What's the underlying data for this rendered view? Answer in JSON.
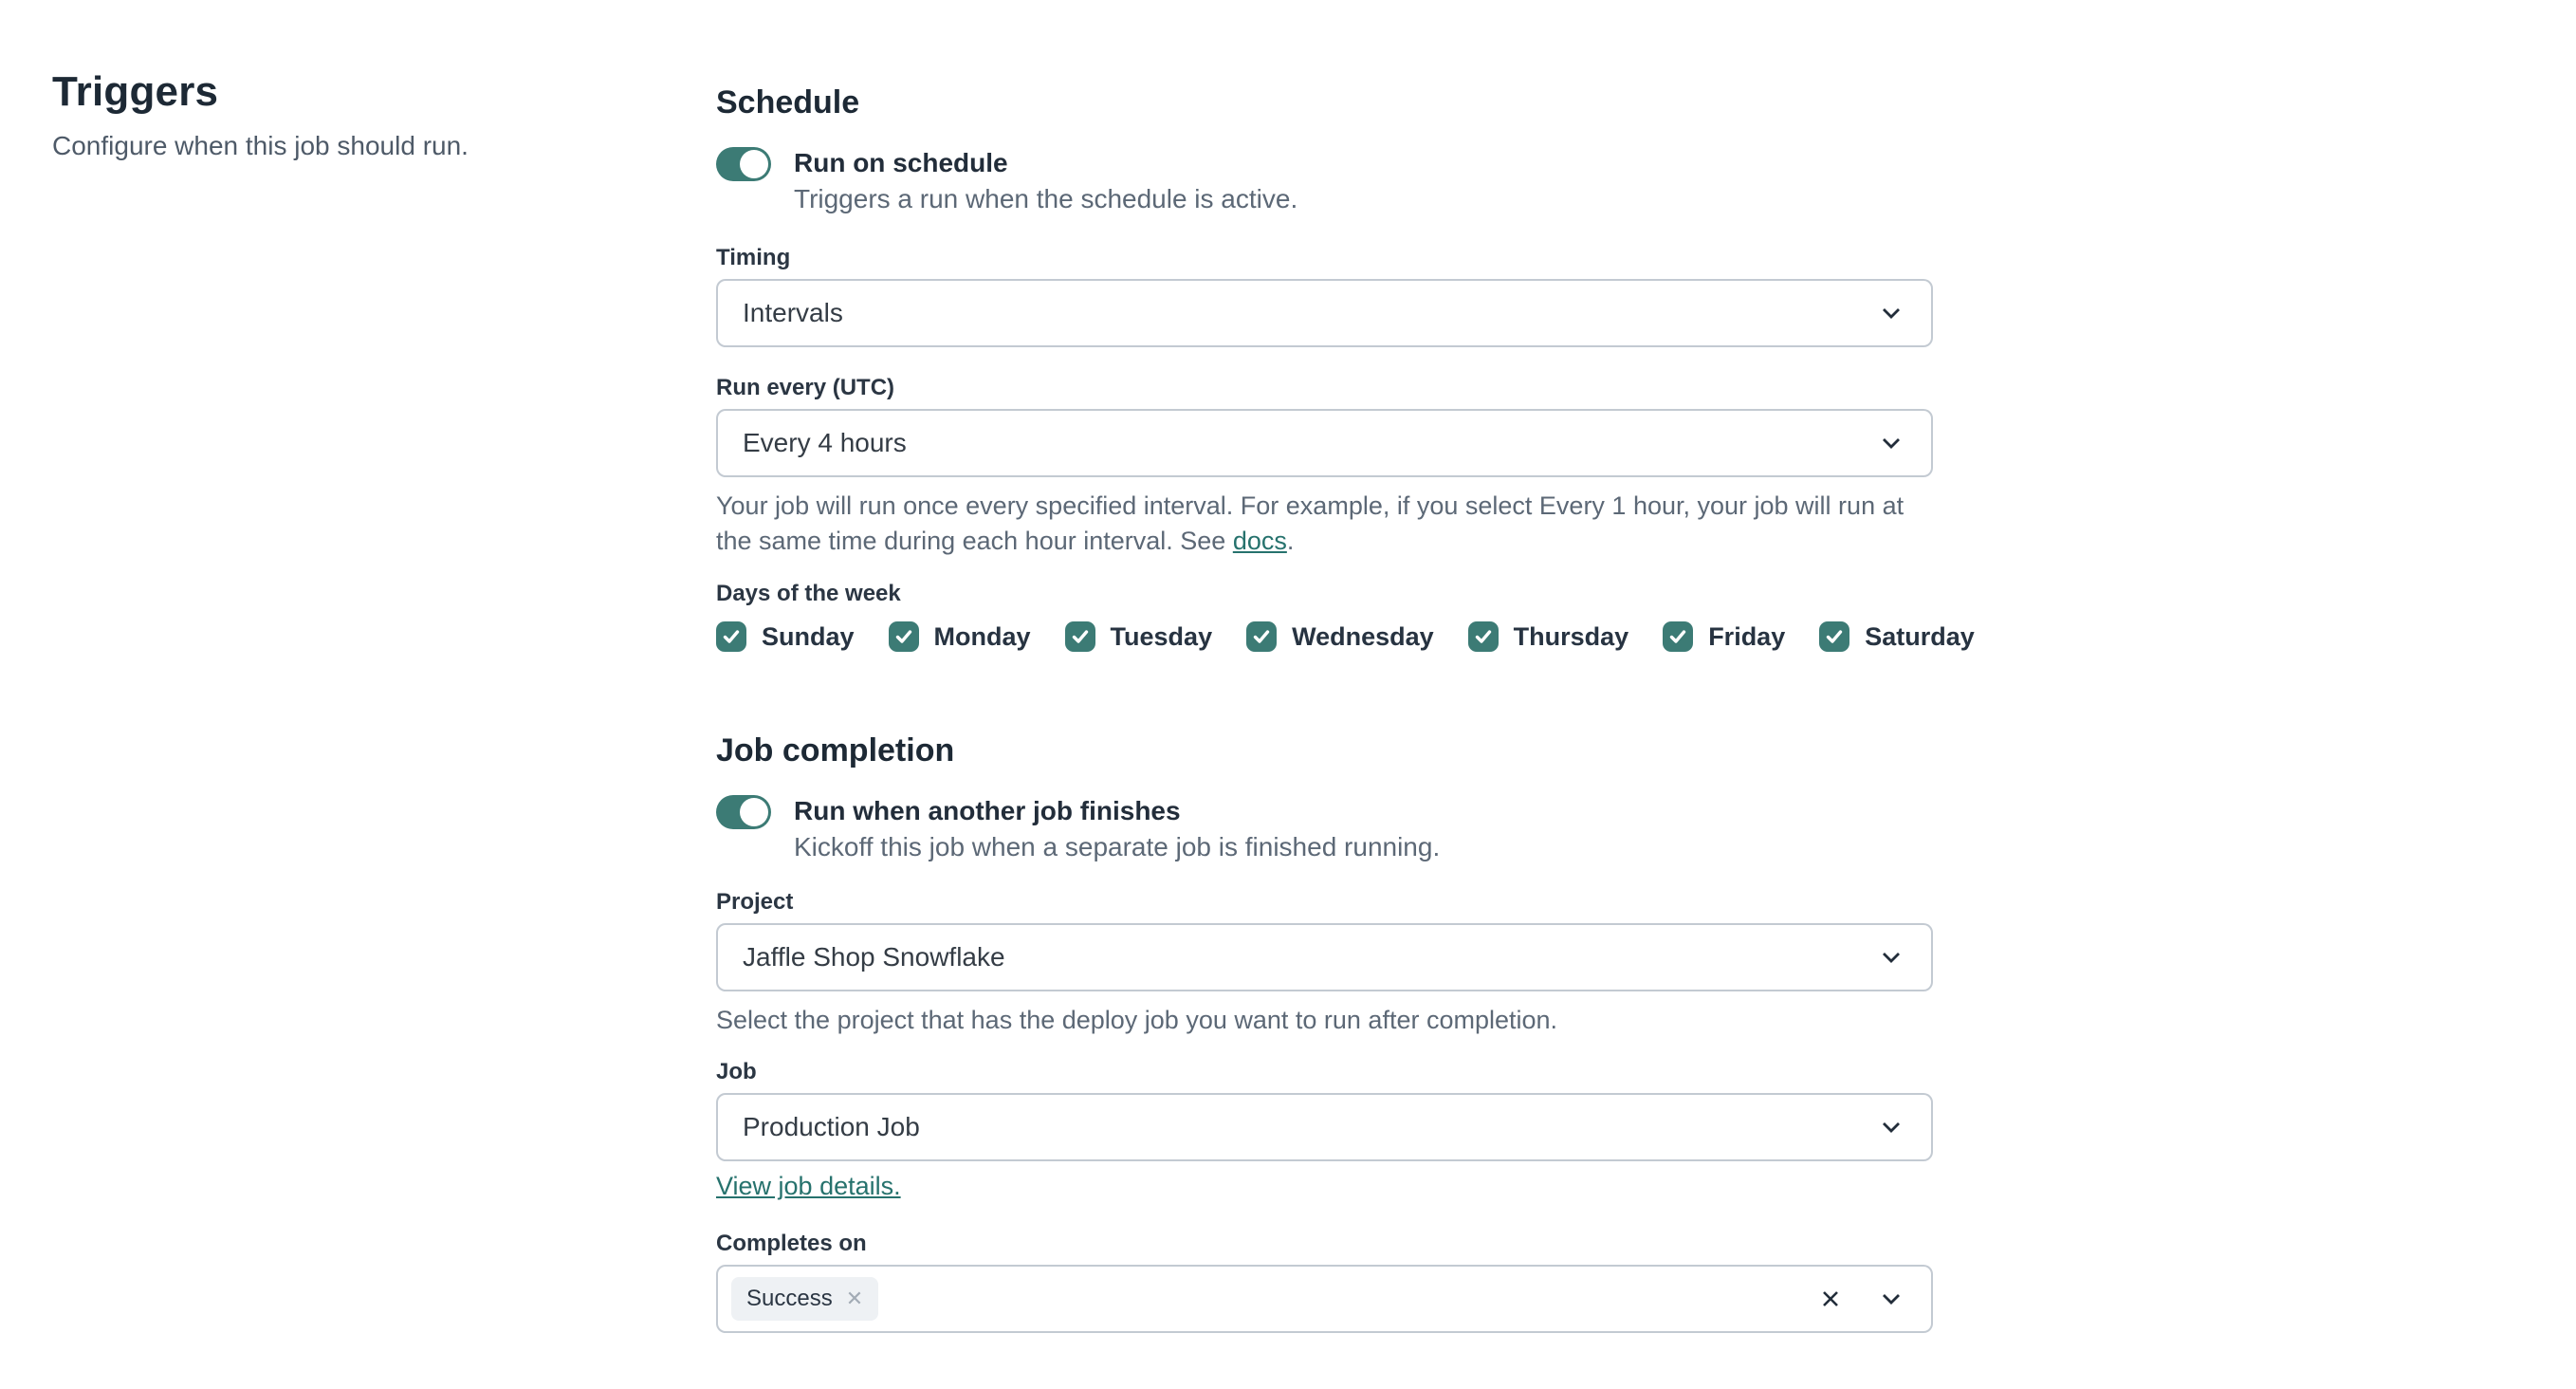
{
  "colors": {
    "accent_teal": "#3c7b75",
    "link_teal": "#26726d",
    "heading_text": "#1d2935",
    "muted_text": "#5c6876",
    "field_border": "#c3cad2",
    "chip_background": "#eef1f4"
  },
  "left": {
    "title": "Triggers",
    "subtitle": "Configure when this job should run."
  },
  "schedule": {
    "heading": "Schedule",
    "toggle": {
      "label": "Run on schedule",
      "description": "Triggers a run when the schedule is active.",
      "state": "on"
    },
    "timing": {
      "label": "Timing",
      "value": "Intervals"
    },
    "run_every": {
      "label": "Run every (UTC)",
      "value": "Every 4 hours",
      "help_before": "Your job will run once every specified interval. For example, if you select Every 1 hour, your job will run at the same time during each hour interval. See ",
      "help_link": "docs",
      "help_after": "."
    },
    "days": {
      "label": "Days of the week",
      "items": [
        {
          "label": "Sunday",
          "checked": true
        },
        {
          "label": "Monday",
          "checked": true
        },
        {
          "label": "Tuesday",
          "checked": true
        },
        {
          "label": "Wednesday",
          "checked": true
        },
        {
          "label": "Thursday",
          "checked": true
        },
        {
          "label": "Friday",
          "checked": true
        },
        {
          "label": "Saturday",
          "checked": true
        }
      ]
    }
  },
  "job_completion": {
    "heading": "Job completion",
    "toggle": {
      "label": "Run when another job finishes",
      "description": "Kickoff this job when a separate job is finished running.",
      "state": "on"
    },
    "project": {
      "label": "Project",
      "value": "Jaffle Shop Snowflake",
      "help": "Select the project that has the deploy job you want to run after completion."
    },
    "job": {
      "label": "Job",
      "value": "Production Job",
      "link": "View job details."
    },
    "completes_on": {
      "label": "Completes on",
      "tags": [
        "Success"
      ]
    }
  }
}
